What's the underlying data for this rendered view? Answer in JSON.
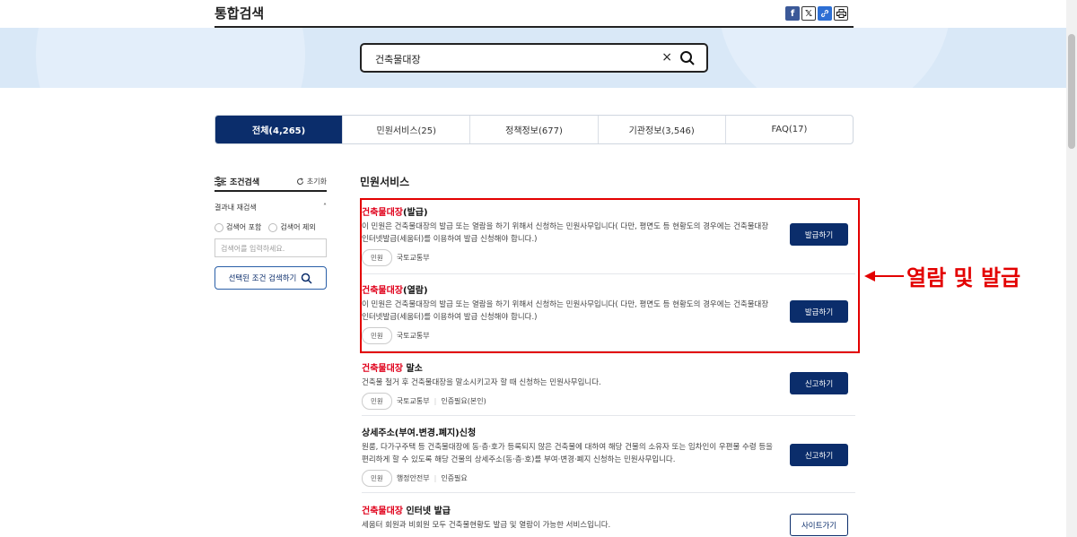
{
  "header": {
    "title": "통합검색",
    "share": {
      "facebook": "f",
      "x": "𝕏",
      "link": "🔗",
      "print": "🖶"
    }
  },
  "search": {
    "value": "건축물대장",
    "clear": "×"
  },
  "tabs": [
    {
      "label": "전체(4,265)",
      "active": true
    },
    {
      "label": "민원서비스(25)",
      "active": false
    },
    {
      "label": "정책정보(677)",
      "active": false
    },
    {
      "label": "기관정보(3,546)",
      "active": false
    },
    {
      "label": "FAQ(17)",
      "active": false
    }
  ],
  "filter": {
    "title": "조건검색",
    "reset": "초기화",
    "refine_label": "결과내 재검색",
    "radio_include": "검색어 포함",
    "radio_exclude": "검색어 제외",
    "placeholder": "검색어를 입력하세요.",
    "submit": "선택된 조건 검색하기"
  },
  "section_title": "민원서비스",
  "results": [
    {
      "title_hl": "건축물대장",
      "title_rest": "(발급)",
      "desc": "이 민원은 건축물대장의 발급 또는 열람을 하기 위해서 신청하는 민원사무입니다( 다만, 평면도 등 현황도의 경우에는 건축물대장 인터넷발급(세움터)를 이용하여 발급 신청해야 합니다.)",
      "pill": "민원",
      "org": "국토교통부",
      "extra": "",
      "button": "발급하기"
    },
    {
      "title_hl": "건축물대장",
      "title_rest": "(열람)",
      "desc": "이 민원은 건축물대장의 발급 또는 열람을 하기 위해서 신청하는 민원사무입니다( 다만, 평면도 등 현황도의 경우에는 건축물대장 인터넷발급(세움터)를 이용하여 발급 신청해야 합니다.)",
      "pill": "민원",
      "org": "국토교통부",
      "extra": "",
      "button": "발급하기"
    },
    {
      "title_hl": "건축물대장",
      "title_rest": " 말소",
      "desc": "건축물 철거 후 건축물대장을 말소시키고자 할 때 신청하는 민원사무입니다.",
      "pill": "민원",
      "org": "국토교통부",
      "extra": "인증필요(본인)",
      "button": "신고하기"
    },
    {
      "title_hl": "",
      "title_rest": "상세주소(부여.변경.폐지)신청",
      "desc": "원룸, 다가구주택 등 건축물대장에 동·층·호가 등록되지 않은 건축물에 대하여 해당 건물의 소유자 또는 임차인이 우편물 수령 등을 편리하게 할 수 있도록 해당 건물의 상세주소(동·층·호)를 부여·변경·폐지 신청하는 민원사무입니다.",
      "pill": "민원",
      "org": "행정안전부",
      "extra": "인증필요",
      "button": "신고하기"
    },
    {
      "title_hl": "건축물대장",
      "title_rest": " 인터넷 발급",
      "desc": "세움터 회원과 비회원 모두 건축물현황도 발급 및 열람이 가능한 서비스입니다.",
      "pill": "",
      "org": "",
      "extra": "",
      "button": "사이트가기"
    }
  ],
  "annotation": {
    "text": "열람 및 발급"
  },
  "colors": {
    "primary": "#0b2d6b",
    "highlight": "#e0001b",
    "annotation": "#e30000",
    "band": "#d9e8f7"
  }
}
